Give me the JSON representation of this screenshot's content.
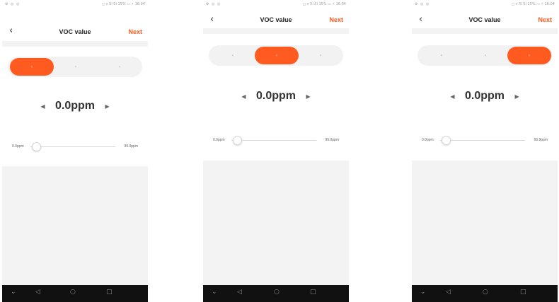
{
  "status_bar": {
    "left": "⚙ ◎ ◎",
    "right": "◻ ⚹ 5l 5l 15% ▭ ⚡ 16:04"
  },
  "nav": {
    "back": "‹",
    "title": "VOC value",
    "next": "Next"
  },
  "segment": {
    "left": "‹",
    "center": "‹",
    "right": "›",
    "active_indices": [
      0,
      1,
      2
    ]
  },
  "value": {
    "display": "0.0ppm",
    "dec": "◀",
    "inc": "▶"
  },
  "slider": {
    "min_label": "0.0ppm",
    "max_label": "99.9ppm",
    "position": 0.0
  },
  "system_nav": {
    "down": "⌄",
    "back": "◁",
    "home": "○",
    "recent": "□"
  },
  "colors": {
    "accent": "#ff5a1f",
    "segment_bg": "#f2f2f2",
    "band": "#f3f3f3",
    "nav_bar": "#111111"
  }
}
